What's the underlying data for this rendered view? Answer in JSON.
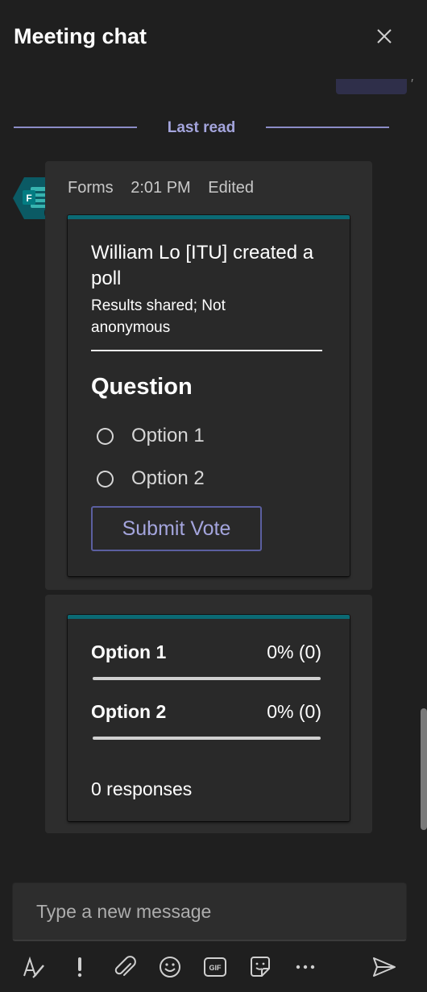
{
  "header": {
    "title": "Meeting chat"
  },
  "divider": {
    "label": "Last read"
  },
  "message": {
    "sender": "Forms",
    "time": "2:01 PM",
    "status": "Edited",
    "avatar_letter": "F",
    "presence": "available"
  },
  "poll": {
    "title": "William Lo [ITU] created a poll",
    "subtitle": "Results shared; Not anonymous",
    "question": "Question",
    "options": [
      {
        "label": "Option 1"
      },
      {
        "label": "Option 2"
      }
    ],
    "submit_label": "Submit Vote"
  },
  "results": {
    "rows": [
      {
        "name": "Option 1",
        "value": "0% (0)",
        "fraction": 0
      },
      {
        "name": "Option 2",
        "value": "0% (0)",
        "fraction": 0
      }
    ],
    "responses": "0 responses"
  },
  "compose": {
    "placeholder": "Type a new message"
  },
  "toolbar": {
    "icons": [
      "format-icon",
      "important-icon",
      "attach-icon",
      "emoji-icon",
      "gif-icon",
      "sticker-icon",
      "more-icon",
      "send-icon"
    ],
    "gif_label": "GIF"
  },
  "colors": {
    "accent": "#a4a5dd",
    "card_border": "#0b6a74",
    "presence_available": "#92c353"
  }
}
